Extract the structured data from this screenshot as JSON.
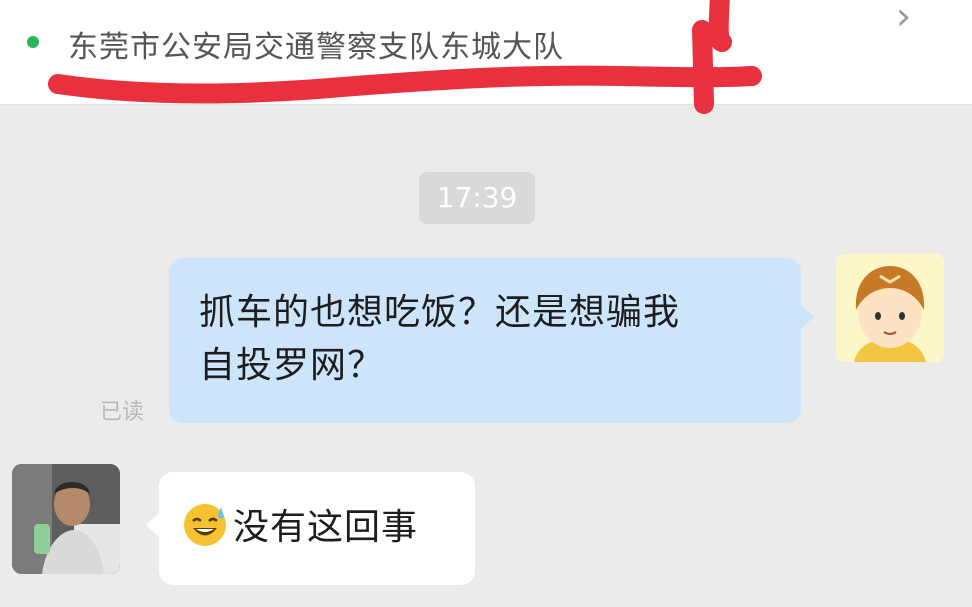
{
  "location_card": {
    "location_name": "东莞市公安局交通警察支队东城大队"
  },
  "chat": {
    "timestamp": "17:39",
    "outgoing_message_line1": "抓车的也想吃饭？还是想骗我",
    "outgoing_message_line2": "自投罗网？",
    "read_status": "已读",
    "incoming_message": "没有这回事",
    "incoming_emoji": "sweat-smile-emoji"
  },
  "colors": {
    "outgoing_bubble": "#cde5fb",
    "incoming_bubble": "#ffffff",
    "location_dot": "#2ab55a",
    "scribble_red": "#e8303e"
  }
}
